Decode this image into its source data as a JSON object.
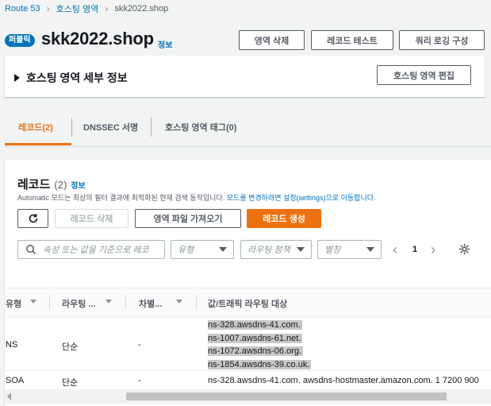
{
  "breadcrumb": {
    "items": [
      "Route 53",
      "호스팅 영역",
      "skk2022.shop"
    ]
  },
  "header": {
    "badge": "퍼블릭",
    "title": "skk2022.shop",
    "info": "정보",
    "buttons": [
      "영역 삭제",
      "레코드 테스트",
      "쿼리 로깅 구성"
    ]
  },
  "details": {
    "title": "호스팅 영역 세부 정보",
    "edit_button": "호스팅 영역 편집"
  },
  "tabs": [
    "레코드(2)",
    "DNSSEC 서명",
    "호스팅 영역 태그(0)"
  ],
  "records": {
    "title": "레코드",
    "count": "(2)",
    "info": "정보",
    "description_prefix": "Automatic 모드는 최상의 필터 결과에 최적화된 현재 검색 동작입니다. ",
    "description_link": "모드를 변경하려면 설정(settings)으로 이동합니다.",
    "buttons": {
      "delete": "레코드 삭제",
      "import": "영역 파일 가져오기",
      "create": "레코드 생성"
    },
    "search_placeholder": "속성 또는 값을 기준으로 레코",
    "filters": [
      "유형",
      "라우팅 정책",
      "별칭"
    ],
    "pagination": {
      "page": "1"
    },
    "columns": [
      "유형",
      "라우팅 ...",
      "차별...",
      "값/트래픽 라우팅 대상"
    ],
    "rows": [
      {
        "type": "NS",
        "routing": "단순",
        "diff": "-",
        "values": [
          "ns-328.awsdns-41.com.",
          "ns-1007.awsdns-61.net.",
          "ns-1072.awsdns-06.org.",
          "ns-1854.awsdns-39.co.uk."
        ]
      },
      {
        "type": "SOA",
        "routing": "단순",
        "diff": "-",
        "values": [
          "ns-328.awsdns-41.com. awsdns-hostmaster.amazon.com. 1 7200 900"
        ]
      }
    ]
  },
  "colors": {
    "accent": "#ec7211",
    "link": "#0073bb",
    "badge": "#0073bb"
  }
}
